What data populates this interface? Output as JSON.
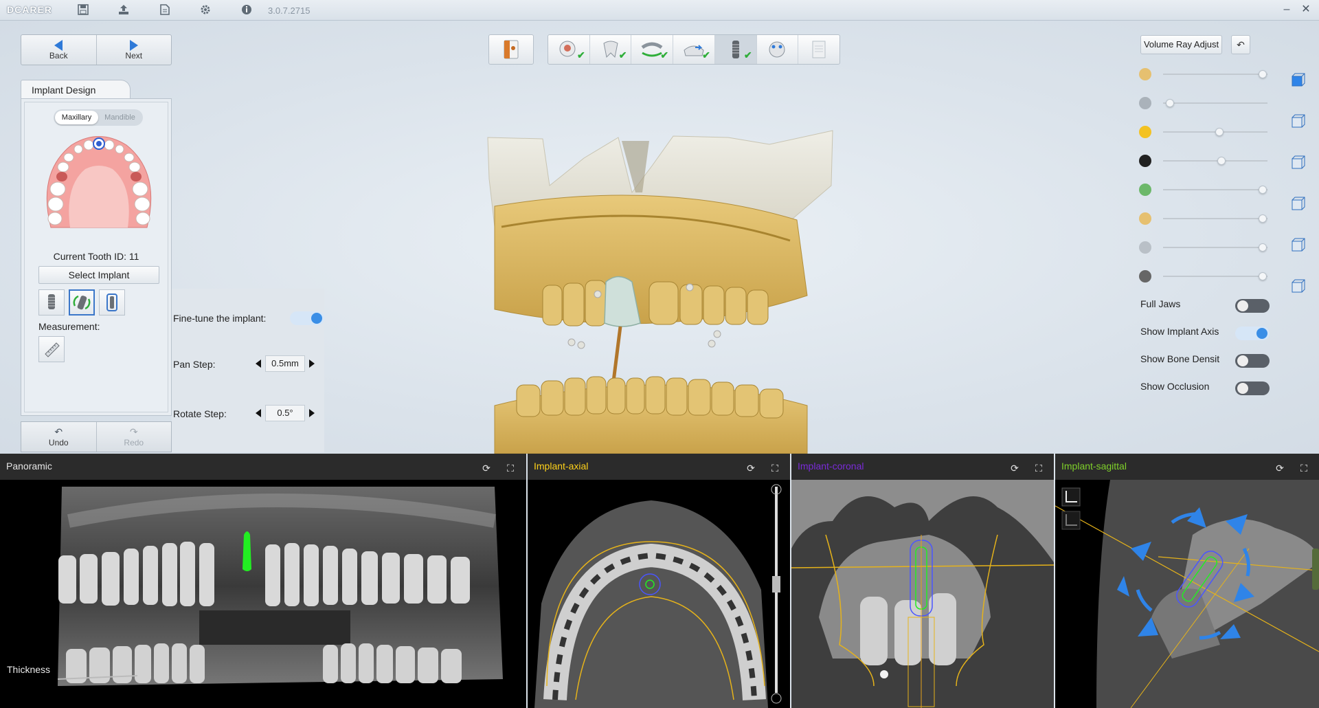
{
  "app": {
    "brand": "DCARER",
    "version": "3.0.7.2715",
    "toolbar_icons": [
      "save-icon",
      "export-icon",
      "document-icon",
      "settings-icon",
      "info-icon"
    ],
    "window_controls": [
      "minimize-icon",
      "close-icon"
    ]
  },
  "nav": {
    "back_label": "Back",
    "next_label": "Next",
    "undo_label": "Undo",
    "redo_label": "Redo"
  },
  "implant_panel": {
    "tab_label": "Implant Design",
    "jaw_options": [
      "Maxillary",
      "Mandible"
    ],
    "jaw_selected": "Maxillary",
    "current_tooth_label": "Current Tooth ID: 11",
    "select_implant_label": "Select Implant",
    "measurement_label": "Measurement:"
  },
  "fine_tune": {
    "label": "Fine-tune the implant:",
    "enabled": true,
    "pan_step_label": "Pan Step:",
    "pan_step_value": "0.5mm",
    "rotate_step_label": "Rotate Step:",
    "rotate_step_value": "0.5°"
  },
  "workflow": {
    "steps": [
      {
        "icon": "scan-patient-icon",
        "done": true
      },
      {
        "icon": "tooth-segment-icon",
        "done": true
      },
      {
        "icon": "arch-align-icon",
        "done": true
      },
      {
        "icon": "model-register-icon",
        "done": true
      },
      {
        "icon": "implant-icon",
        "done": true
      },
      {
        "icon": "guide-design-icon",
        "done": false
      },
      {
        "icon": "report-icon",
        "done": false
      }
    ],
    "current_step": 4
  },
  "right_panel": {
    "volume_ray_label": "Volume Ray Adjust",
    "sliders": [
      {
        "icon": "upper-jaw-icon",
        "value": 0.95
      },
      {
        "icon": "lower-jaw-icon",
        "value": 0.03
      },
      {
        "icon": "brightness-icon",
        "value": 0.52
      },
      {
        "icon": "contrast-icon",
        "value": 0.54
      },
      {
        "icon": "upper-model-icon",
        "value": 0.95
      },
      {
        "icon": "lower-model-icon",
        "value": 0.95
      },
      {
        "icon": "crown-icon",
        "value": 0.95
      },
      {
        "icon": "implant-icon",
        "value": 0.95
      }
    ],
    "options": [
      {
        "label": "Full Jaws",
        "on": false
      },
      {
        "label": "Show Implant Axis",
        "on": true
      },
      {
        "label": "Show Bone Densit",
        "on": false
      },
      {
        "label": "Show Occlusion",
        "on": false
      }
    ]
  },
  "viewports": {
    "panoramic": {
      "title": "Panoramic",
      "thickness_label": "Thickness",
      "title_color": "#e6e6e6"
    },
    "axial": {
      "title": "Implant-axial",
      "title_color": "#ffd21a"
    },
    "coronal": {
      "title": "Implant-coronal",
      "title_color": "#7a2bd8"
    },
    "sagittal": {
      "title": "Implant-sagittal",
      "title_color": "#7fd12a"
    }
  },
  "colors": {
    "accent": "#3a8ee6",
    "implant_green": "#22ee22",
    "outline_yellow": "#e6b31a",
    "implant_blue": "#4a55ff"
  }
}
